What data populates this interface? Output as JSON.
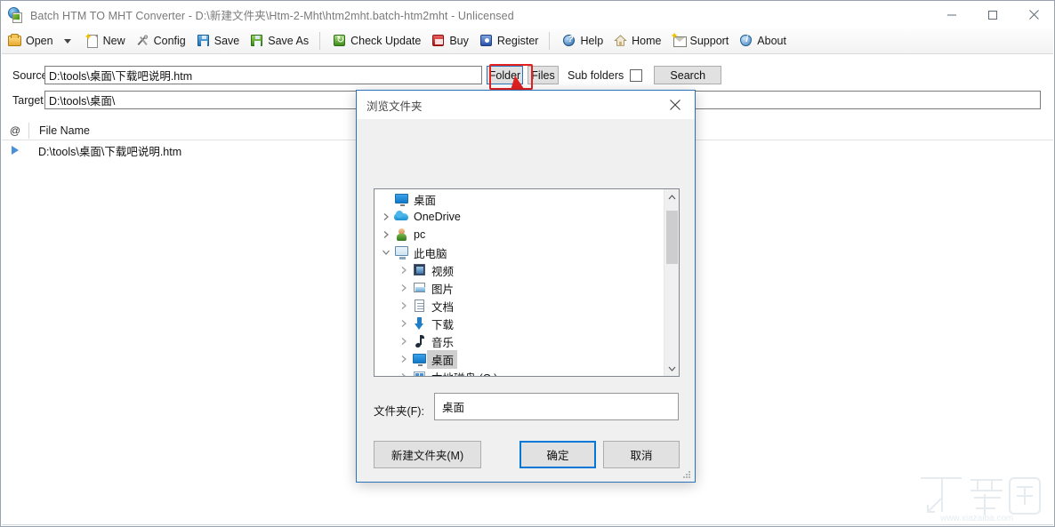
{
  "window": {
    "title": "Batch HTM TO MHT Converter - D:\\新建文件夹\\Htm-2-Mht\\htm2mht.batch-htm2mht - Unlicensed",
    "app_icon": "globe-page-icon",
    "controls": {
      "minimize": "minimize-icon",
      "maximize": "maximize-icon",
      "close": "close-icon"
    }
  },
  "toolbar": {
    "items": [
      {
        "label": "Open",
        "icon": "open-folder-icon",
        "dropdown": true
      },
      {
        "label": "New",
        "icon": "new-document-icon",
        "dropdown": false
      },
      {
        "label": "Config",
        "icon": "tools-icon",
        "dropdown": false
      },
      {
        "label": "Save",
        "icon": "floppy-disk-icon",
        "dropdown": false
      },
      {
        "label": "Save As",
        "icon": "floppy-disk-green-icon",
        "dropdown": false
      },
      {
        "label": "Check Update",
        "icon": "refresh-icon",
        "dropdown": false
      },
      {
        "label": "Buy",
        "icon": "cart-icon",
        "dropdown": false
      },
      {
        "label": "Register",
        "icon": "key-user-icon",
        "dropdown": false
      },
      {
        "label": "Help",
        "icon": "help-circle-icon",
        "dropdown": false
      },
      {
        "label": "Home",
        "icon": "home-icon",
        "dropdown": false
      },
      {
        "label": "Support",
        "icon": "envelope-icon",
        "dropdown": false
      },
      {
        "label": "About",
        "icon": "info-icon",
        "dropdown": false
      }
    ]
  },
  "source_row": {
    "label": "Source",
    "value": "D:\\tools\\桌面\\下载吧说明.htm",
    "folder_button": "Folder",
    "files_button": "Files",
    "subfolders_label": "Sub folders",
    "subfolders_checked": false,
    "search_button": "Search",
    "highlight_color": "#e52020"
  },
  "target_row": {
    "label": "Target",
    "value": "D:\\tools\\桌面\\"
  },
  "file_list": {
    "columns": [
      "@",
      "File Name"
    ],
    "rows": [
      {
        "marker": "play-triangle-icon",
        "file_name": "D:\\tools\\桌面\\下载吧说明.htm"
      }
    ]
  },
  "dialog": {
    "title": "浏览文件夹",
    "close_icon": "close-icon",
    "tree": [
      {
        "label": "桌面",
        "icon": "desktop-icon",
        "indent": 0,
        "expander": "none",
        "selected": false
      },
      {
        "label": "OneDrive",
        "icon": "onedrive-icon",
        "indent": 1,
        "expander": "collapsed",
        "selected": false
      },
      {
        "label": "pc",
        "icon": "user-icon",
        "indent": 1,
        "expander": "collapsed",
        "selected": false
      },
      {
        "label": "此电脑",
        "icon": "pc-icon",
        "indent": 1,
        "expander": "expanded",
        "selected": false
      },
      {
        "label": "视频",
        "icon": "video-icon",
        "indent": 2,
        "expander": "collapsed",
        "selected": false
      },
      {
        "label": "图片",
        "icon": "pictures-icon",
        "indent": 2,
        "expander": "collapsed",
        "selected": false
      },
      {
        "label": "文档",
        "icon": "documents-icon",
        "indent": 2,
        "expander": "collapsed",
        "selected": false
      },
      {
        "label": "下载",
        "icon": "downloads-icon",
        "indent": 2,
        "expander": "collapsed",
        "selected": false
      },
      {
        "label": "音乐",
        "icon": "music-icon",
        "indent": 2,
        "expander": "collapsed",
        "selected": false
      },
      {
        "label": "桌面",
        "icon": "desktop-icon",
        "indent": 2,
        "expander": "collapsed",
        "selected": true
      },
      {
        "label": "本地磁盘 (C:)",
        "icon": "disk-icon",
        "indent": 2,
        "expander": "collapsed",
        "selected": false
      }
    ],
    "folder_field": {
      "label": "文件夹(F):",
      "value": "桌面"
    },
    "buttons": {
      "new_folder": "新建文件夹(M)",
      "ok": "确定",
      "cancel": "取消",
      "default_button": "确定",
      "accent_color": "#0078d7"
    }
  },
  "watermark": {
    "text": "www.xiazaiba.com",
    "logo": "下载吧"
  }
}
